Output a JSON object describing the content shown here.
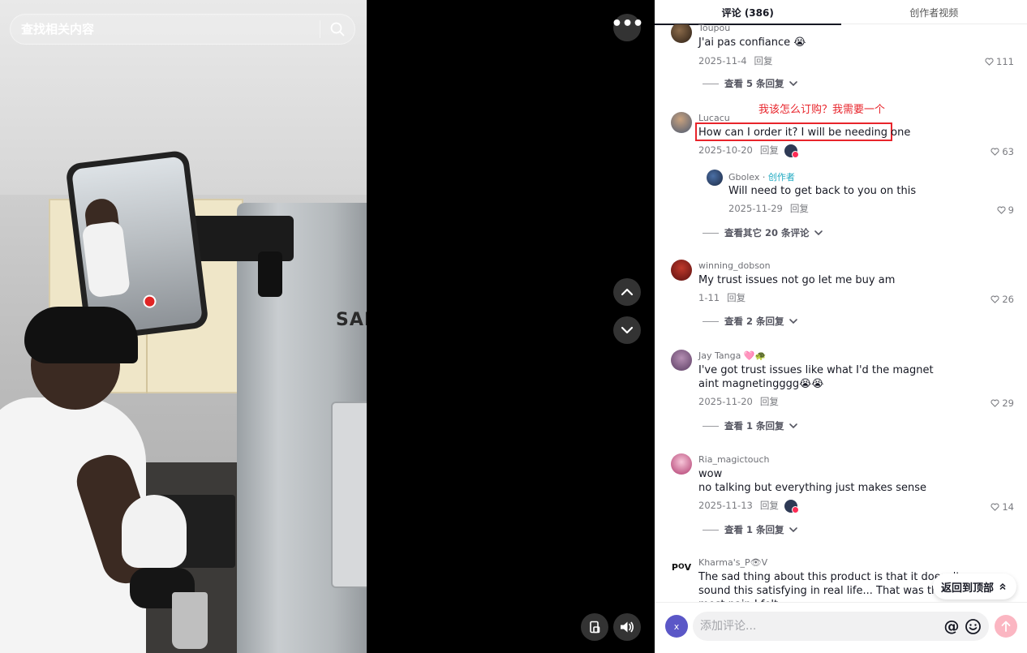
{
  "search": {
    "placeholder": "查找相关内容"
  },
  "video": {
    "brand_text": "SAMS"
  },
  "tabs": [
    {
      "label": "评论 (386)",
      "active": true
    },
    {
      "label": "创作者视频",
      "active": false
    }
  ],
  "comments": [
    {
      "user": "Toupou",
      "text": "J'ai pas confiance 😭",
      "date": "2025-11-4",
      "reply": "回复",
      "likes": "111",
      "more_replies": "查看 5 条回复"
    },
    {
      "user": "Lucacu",
      "text": "How can I order it? I will be needing one",
      "translation": "我该怎么订购？我需要一个",
      "date": "2025-10-20",
      "reply": "回复",
      "likes": "63",
      "creator_reply": {
        "user": "Gbolex",
        "tag": "创作者",
        "text": "Will need to get back to you on this",
        "date": "2025-11-29",
        "reply": "回复",
        "likes": "9"
      },
      "more_replies": "查看其它 20 条评论"
    },
    {
      "user": "winning_dobson",
      "text": "My trust issues not go let me buy am",
      "date": "1-11",
      "reply": "回复",
      "likes": "26",
      "more_replies": "查看 2 条回复"
    },
    {
      "user": "Jay Tanga 🩷🐢",
      "text": "I've got trust issues like what I'd the magnet aint magnetingggg😭😭",
      "date": "2025-11-20",
      "reply": "回复",
      "likes": "29",
      "more_replies": "查看 1 条回复"
    },
    {
      "user": "Ria_magictouch",
      "text": "wow",
      "text2": "no talking but everything just makes sense",
      "date": "2025-11-13",
      "reply": "回复",
      "likes": "14",
      "more_replies": "查看 1 条回复"
    },
    {
      "user": "Kharma's_P👁V",
      "text": "The sad thing about this product is that it doesn't sound this satisfying in real life... That was the most pain I felt"
    }
  ],
  "back_to_top": "返回到顶部",
  "composer": {
    "avatar_letter": "x",
    "placeholder": "添加评论..."
  },
  "icons": [
    "search-icon",
    "more-icon",
    "chevron-up-icon",
    "chevron-down-icon",
    "pip-icon",
    "volume-icon",
    "heart-icon",
    "chevron-down-small-icon",
    "at-icon",
    "emoji-icon",
    "send-arrow-icon"
  ],
  "colors": {
    "accent_red": "#e8242b",
    "creator": "#20aac2",
    "send_disabled": "#fbb6c2"
  }
}
